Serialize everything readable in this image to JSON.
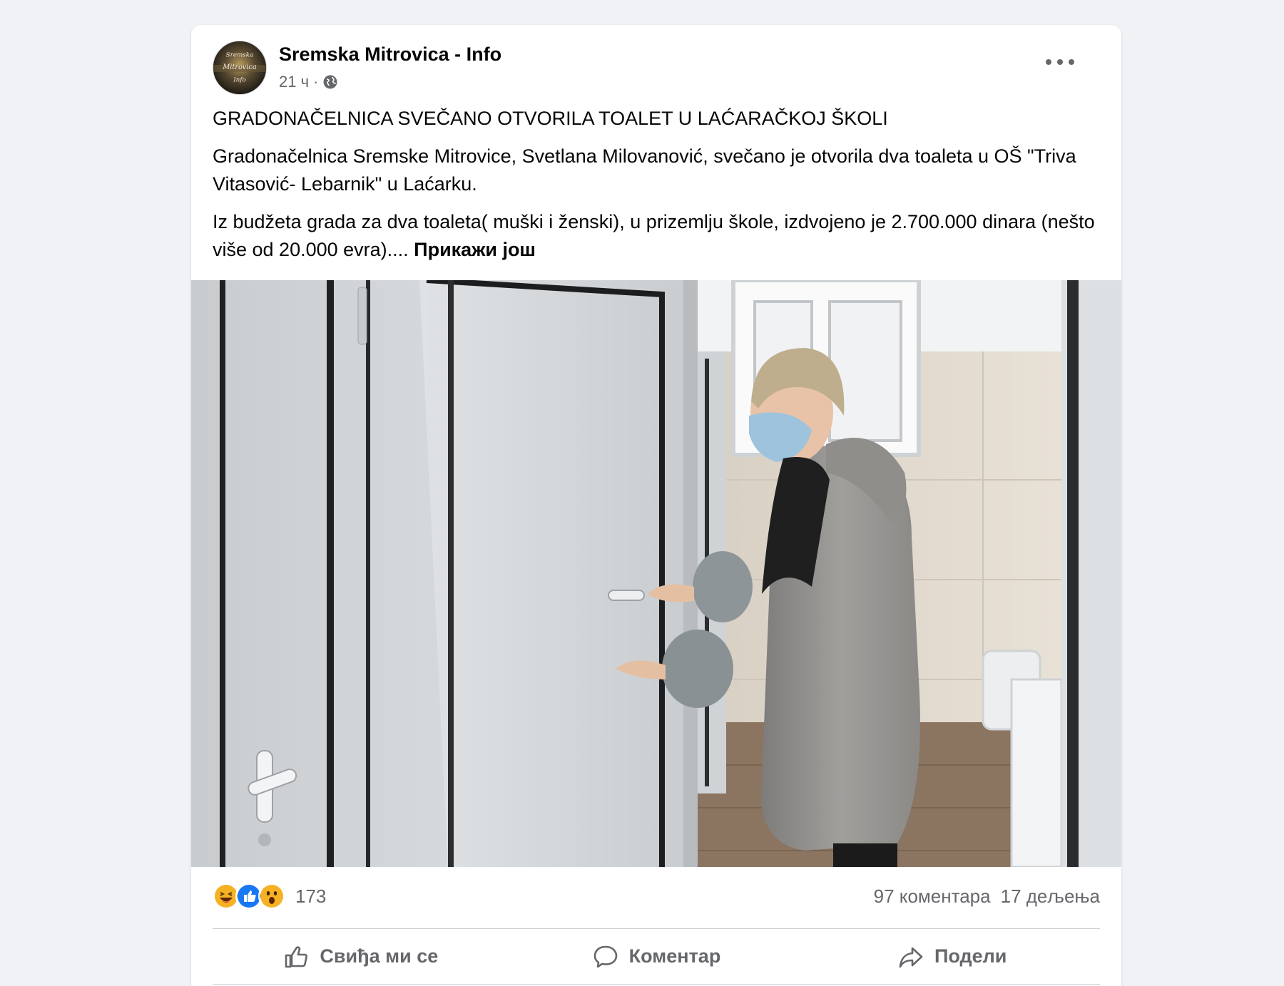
{
  "post": {
    "page_name": "Sremska Mitrovica - Info",
    "time": "21 ч",
    "separator": "·",
    "headline": "GRADONAČELNICA SVEČANO OTVORILA TOALET U LAĆARAČKOJ ŠKOLI",
    "paragraph_1": "Gradonačelnica Sremske Mitrovice, Svetlana Milovanović, svečano je otvorila dva toaleta u OŠ \"Triva Vitasović- Lebarnik\" u Laćarku.",
    "paragraph_2": "Iz budžeta grada za dva toaleta( muški i ženski), u prizemlju škole, izdvojeno je 2.700.000 dinara (nešto više od 20.000 evra)....",
    "see_more": "Прикажи још"
  },
  "reactions": {
    "types": [
      "haha",
      "like",
      "wow"
    ],
    "count": "173",
    "comments": "97 коментара",
    "shares": "17 дељења"
  },
  "actions": {
    "like": "Свиђа ми се",
    "comment": "Коментар",
    "share": "Подели"
  },
  "avatar": {
    "logo_text": [
      "Sremska",
      "Mitrovica",
      "Info"
    ]
  }
}
